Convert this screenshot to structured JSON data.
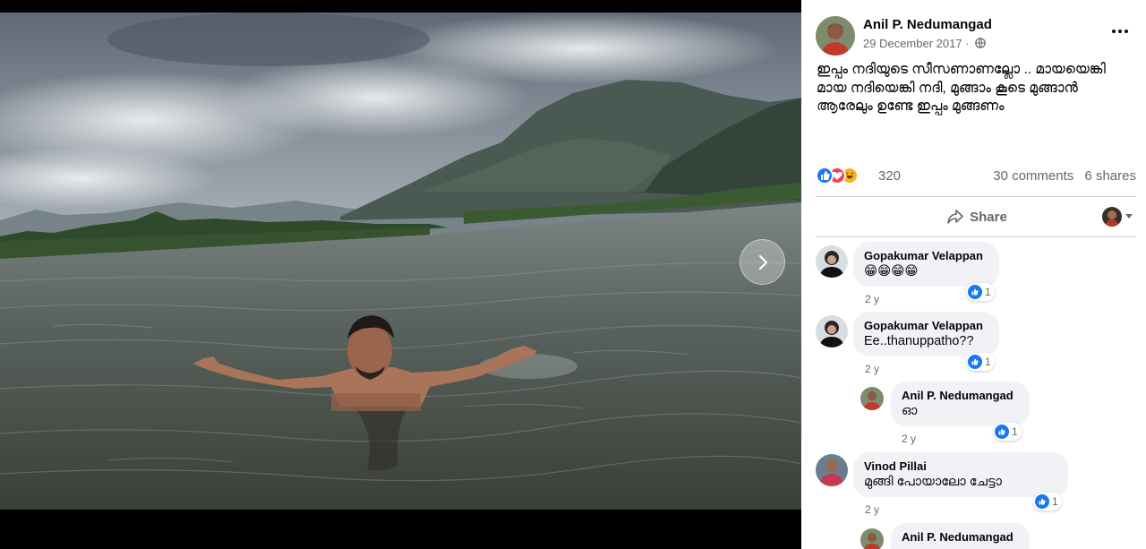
{
  "viewer": {
    "next_label": "Next photo"
  },
  "post": {
    "author": "Anil P. Nedumangad",
    "date": "29 December 2017 ·",
    "text": "ഇപ്പം നദിയുടെ സീസണാണല്ലോ .. മായയെങ്കി മായ നദിയെങ്കി നദി, മുങ്ങാം കൂടെ മുങ്ങാൻ ആരേലും ഉണ്ടേ ഇപ്പം മുങ്ങണം",
    "reaction_count": "320",
    "comments_count": "30 comments",
    "shares_count": "6 shares",
    "share_label": "Share"
  },
  "comments": [
    {
      "name": "Gopakumar Velappan",
      "text": "😁😁😁😁",
      "time": "2 y",
      "likes": "1"
    },
    {
      "name": "Gopakumar Velappan",
      "text": "Ee..thanuppatho??",
      "time": "2 y",
      "likes": "1"
    },
    {
      "name": "Anil P. Nedumangad",
      "text": "ഓ",
      "time": "2 y",
      "likes": "1"
    },
    {
      "name": "Vinod Pillai",
      "text": "മുങ്ങി പോയാലോ ചേട്ടാ",
      "time": "2 y",
      "likes": "1"
    },
    {
      "name": "Anil P. Nedumangad",
      "text": "",
      "time": "",
      "likes": ""
    }
  ],
  "colors": {
    "facebook_blue": "#1877f2",
    "love_red": "#f33e58",
    "haha_yellow": "#f7b125",
    "secondary_text": "#65676b",
    "bubble_bg": "#f0f2f5"
  },
  "icons": {
    "next": "chevron-right-icon",
    "privacy": "globe-icon",
    "more": "more-options-icon",
    "share": "share-arrow-icon",
    "like": "thumbs-up-icon"
  }
}
